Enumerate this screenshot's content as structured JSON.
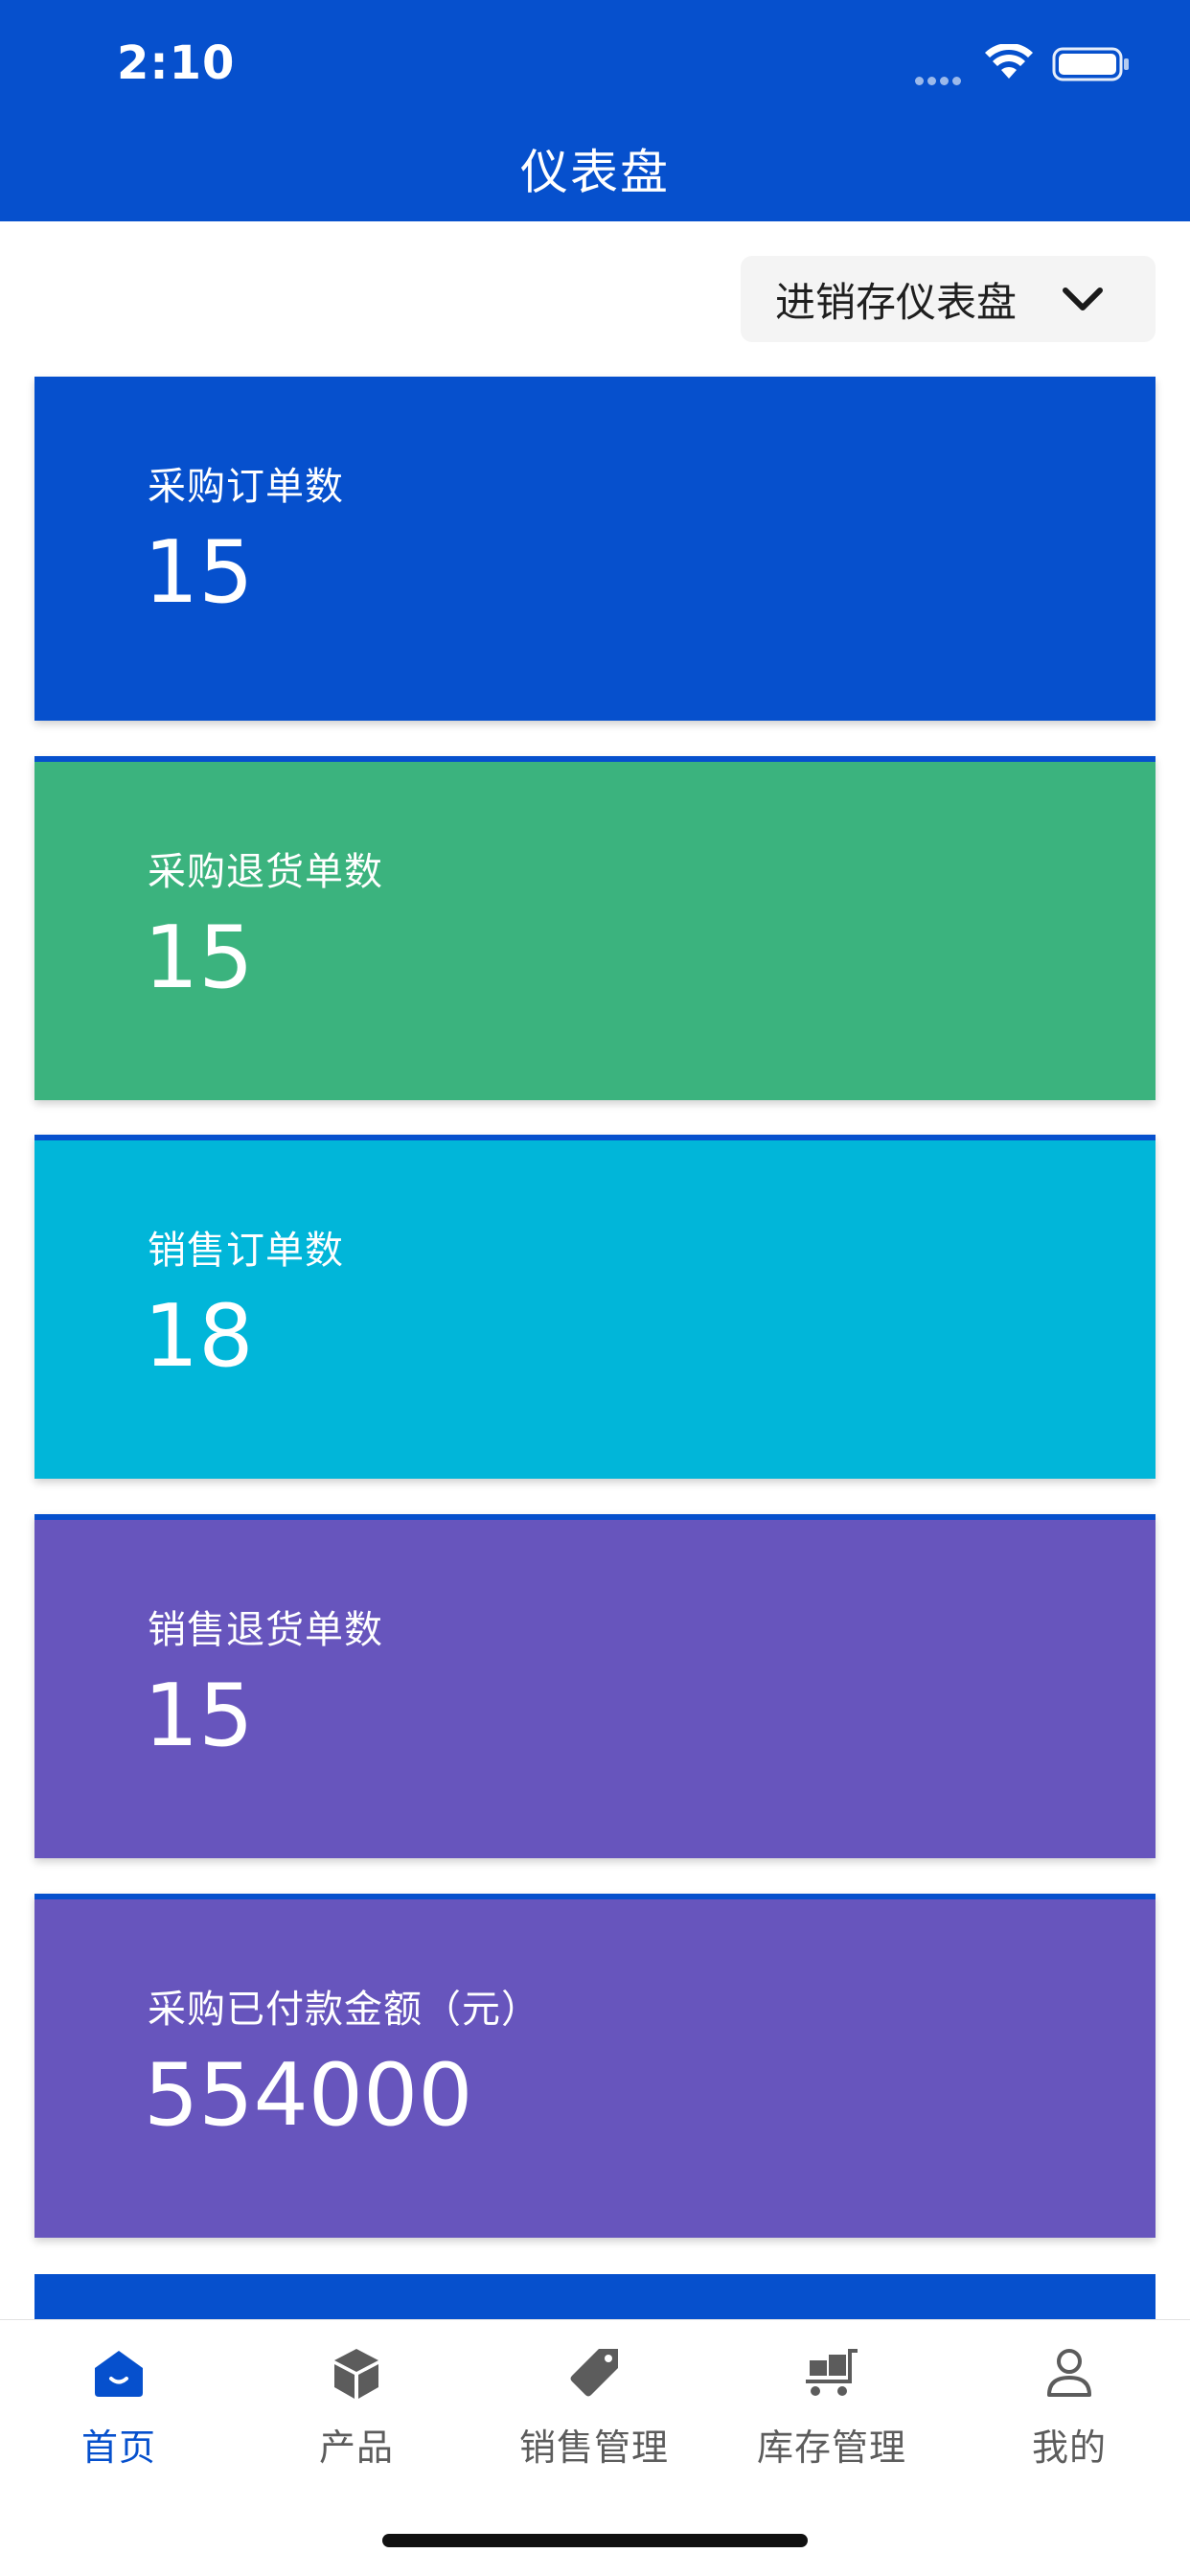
{
  "status_bar": {
    "time": "2:10"
  },
  "header": {
    "title": "仪表盘"
  },
  "dropdown": {
    "selected": "进销存仪表盘"
  },
  "cards": [
    {
      "label": "采购订单数",
      "value": "15",
      "color": "#0650cd"
    },
    {
      "label": "采购退货单数",
      "value": "15",
      "color": "#3bb37e"
    },
    {
      "label": "销售订单数",
      "value": "18",
      "color": "#01b6d9"
    },
    {
      "label": "销售退货单数",
      "value": "15",
      "color": "#6755bd"
    },
    {
      "label": "采购已付款金额（元）",
      "value": "554000",
      "color": "#6755bd"
    }
  ],
  "tabbar": {
    "active_color": "#0650cd",
    "items": [
      {
        "label": "首页",
        "icon": "home-icon",
        "active": true
      },
      {
        "label": "产品",
        "icon": "box-icon",
        "active": false
      },
      {
        "label": "销售管理",
        "icon": "tag-icon",
        "active": false
      },
      {
        "label": "库存管理",
        "icon": "cart-icon",
        "active": false
      },
      {
        "label": "我的",
        "icon": "user-icon",
        "active": false
      }
    ]
  }
}
